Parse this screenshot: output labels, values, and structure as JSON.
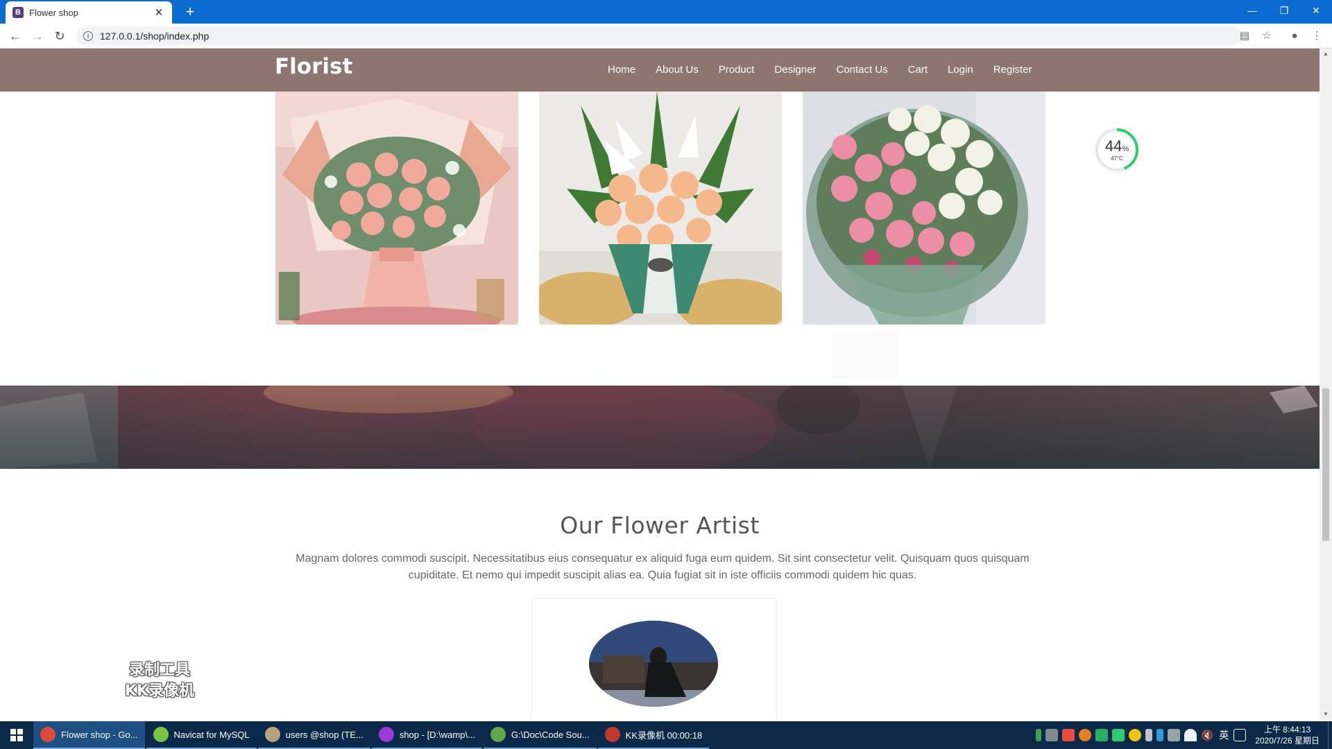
{
  "browser": {
    "tab_title": "Flower shop",
    "tab_favicon": "B",
    "url": "127.0.0.1/shop/index.php",
    "new_tab_symbol": "+",
    "close_symbol": "✕"
  },
  "site": {
    "brand": "Florist",
    "nav": [
      "Home",
      "About Us",
      "Product",
      "Designer",
      "Contact Us",
      "Cart",
      "Login",
      "Register"
    ]
  },
  "artists": {
    "title": "Our Flower Artist",
    "description": "Magnam dolores commodi suscipit. Necessitatibus eius consequatur ex aliquid fuga eum quidem. Sit sint consectetur velit. Quisquam quos quisquam cupiditate. Et nemo qui impedit suscipit alias ea. Quia fugiat sit in iste officiis commodi quidem hic quas."
  },
  "overlays": {
    "cpu_percent": "44",
    "cpu_unit": "%",
    "cpu_temp": "47°C",
    "watermark_line1": "录制工具",
    "watermark_line2": "KK录像机",
    "back_to_top": "⌃"
  },
  "taskbar": {
    "items": [
      {
        "label": "Flower shop - Go...",
        "icon": "chrome-icon",
        "color": "#dd4b39",
        "active": true
      },
      {
        "label": "Navicat for MySQL",
        "icon": "navicat-icon",
        "color": "#7cc242",
        "active": false
      },
      {
        "label": "users @shop (TE...",
        "icon": "database-icon",
        "color": "#b9a27a",
        "active": false
      },
      {
        "label": "shop - [D:\\wamp\\...",
        "icon": "phpstorm-icon",
        "color": "#9c3ad6",
        "active": false
      },
      {
        "label": "G:\\Doc\\Code Sou...",
        "icon": "notepad-icon",
        "color": "#5ea84a",
        "active": false
      },
      {
        "label": "KK录像机 00:00:18",
        "icon": "kk-recorder-icon",
        "color": "#c0392b",
        "active": false
      }
    ],
    "ime": "英",
    "clock_time": "上午 8:44:13",
    "clock_date": "2020/7/26 星期日"
  },
  "colors": {
    "browser_chrome": "#0c6bd0",
    "site_navbar": "#8d7570",
    "taskbar": "#0b2a4a",
    "back_to_top": "#8db6c9",
    "gauge_ring": "#2ecc71"
  }
}
